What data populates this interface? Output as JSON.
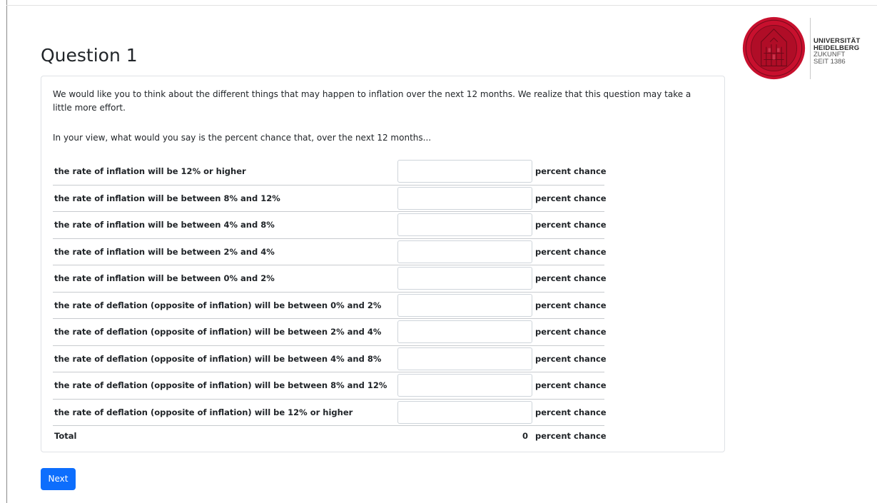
{
  "page": {
    "title": "Question 1"
  },
  "logo": {
    "line1": "UNIVERSITÄT",
    "line2": "HEIDELBERG",
    "line3": "ZUKUNFT",
    "line4": "SEIT 1386",
    "seal_color": "#c8102e"
  },
  "question": {
    "intro": "We would like you to think about the different things that may happen to inflation over the next 12 months. We realize that this question may take a little more effort.",
    "prompt": "In your view, what would you say is the percent chance that, over the next 12 months...",
    "unit_label": "percent chance",
    "rows": [
      {
        "label": "the rate of inflation will be 12% or higher",
        "value": ""
      },
      {
        "label": "the rate of inflation will be between 8% and 12%",
        "value": ""
      },
      {
        "label": "the rate of inflation will be between 4% and 8%",
        "value": ""
      },
      {
        "label": "the rate of inflation will be between 2% and 4%",
        "value": ""
      },
      {
        "label": "the rate of inflation will be between 0% and 2%",
        "value": ""
      },
      {
        "label": "the rate of deflation (opposite of inflation) will be between 0% and 2%",
        "value": ""
      },
      {
        "label": "the rate of deflation (opposite of inflation) will be between 2% and 4%",
        "value": ""
      },
      {
        "label": "the rate of deflation (opposite of inflation) will be between 4% and 8%",
        "value": ""
      },
      {
        "label": "the rate of deflation (opposite of inflation) will be between 8% and 12%",
        "value": ""
      },
      {
        "label": "the rate of deflation (opposite of inflation) will be 12% or higher",
        "value": ""
      }
    ],
    "total_label": "Total",
    "total_value": "0"
  },
  "actions": {
    "next_label": "Next",
    "accent": "#0d6efd"
  }
}
